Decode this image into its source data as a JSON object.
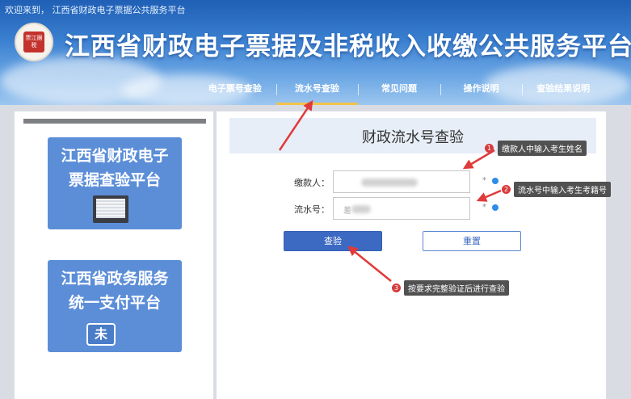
{
  "header": {
    "welcome": "欢迎来到， 江西省财政电子票据公共服务平台",
    "logo_text": "票江据税",
    "title": "江西省财政电子票据及非税收入收缴公共服务平台"
  },
  "nav": {
    "items": [
      {
        "label": "电子票号查验"
      },
      {
        "label": "流水号查验"
      },
      {
        "label": "常见问题"
      },
      {
        "label": "操作说明"
      },
      {
        "label": "查验结果说明"
      }
    ],
    "active": "流水号查验"
  },
  "sidebar": {
    "cards": [
      {
        "line1": "江西省财政电子",
        "line2": "票据查验平台"
      },
      {
        "line1": "江西省政务服务",
        "line2": "统一支付平台",
        "icon_char": "未"
      }
    ]
  },
  "form": {
    "title": "财政流水号查验",
    "payer_label": "缴款人：",
    "serial_label": "流水号：",
    "serial_value_start": "差",
    "required_mark": "*",
    "query_button": "查验",
    "reset_button": "重置"
  },
  "annotations": [
    {
      "num": "1",
      "text": "缴款人中输入考生姓名"
    },
    {
      "num": "2",
      "text": "流水号中输入考生考籍号"
    },
    {
      "num": "3",
      "text": "按要求完整验证后进行查验"
    }
  ],
  "colors": {
    "header_top": "#1f5fb5",
    "nav_active_underline": "#f0c34a",
    "card_bg": "#5c8ed8",
    "primary_button": "#3c69c2",
    "annotation_arrow": "#e03a3a",
    "check_icon": "#2e8de8"
  }
}
